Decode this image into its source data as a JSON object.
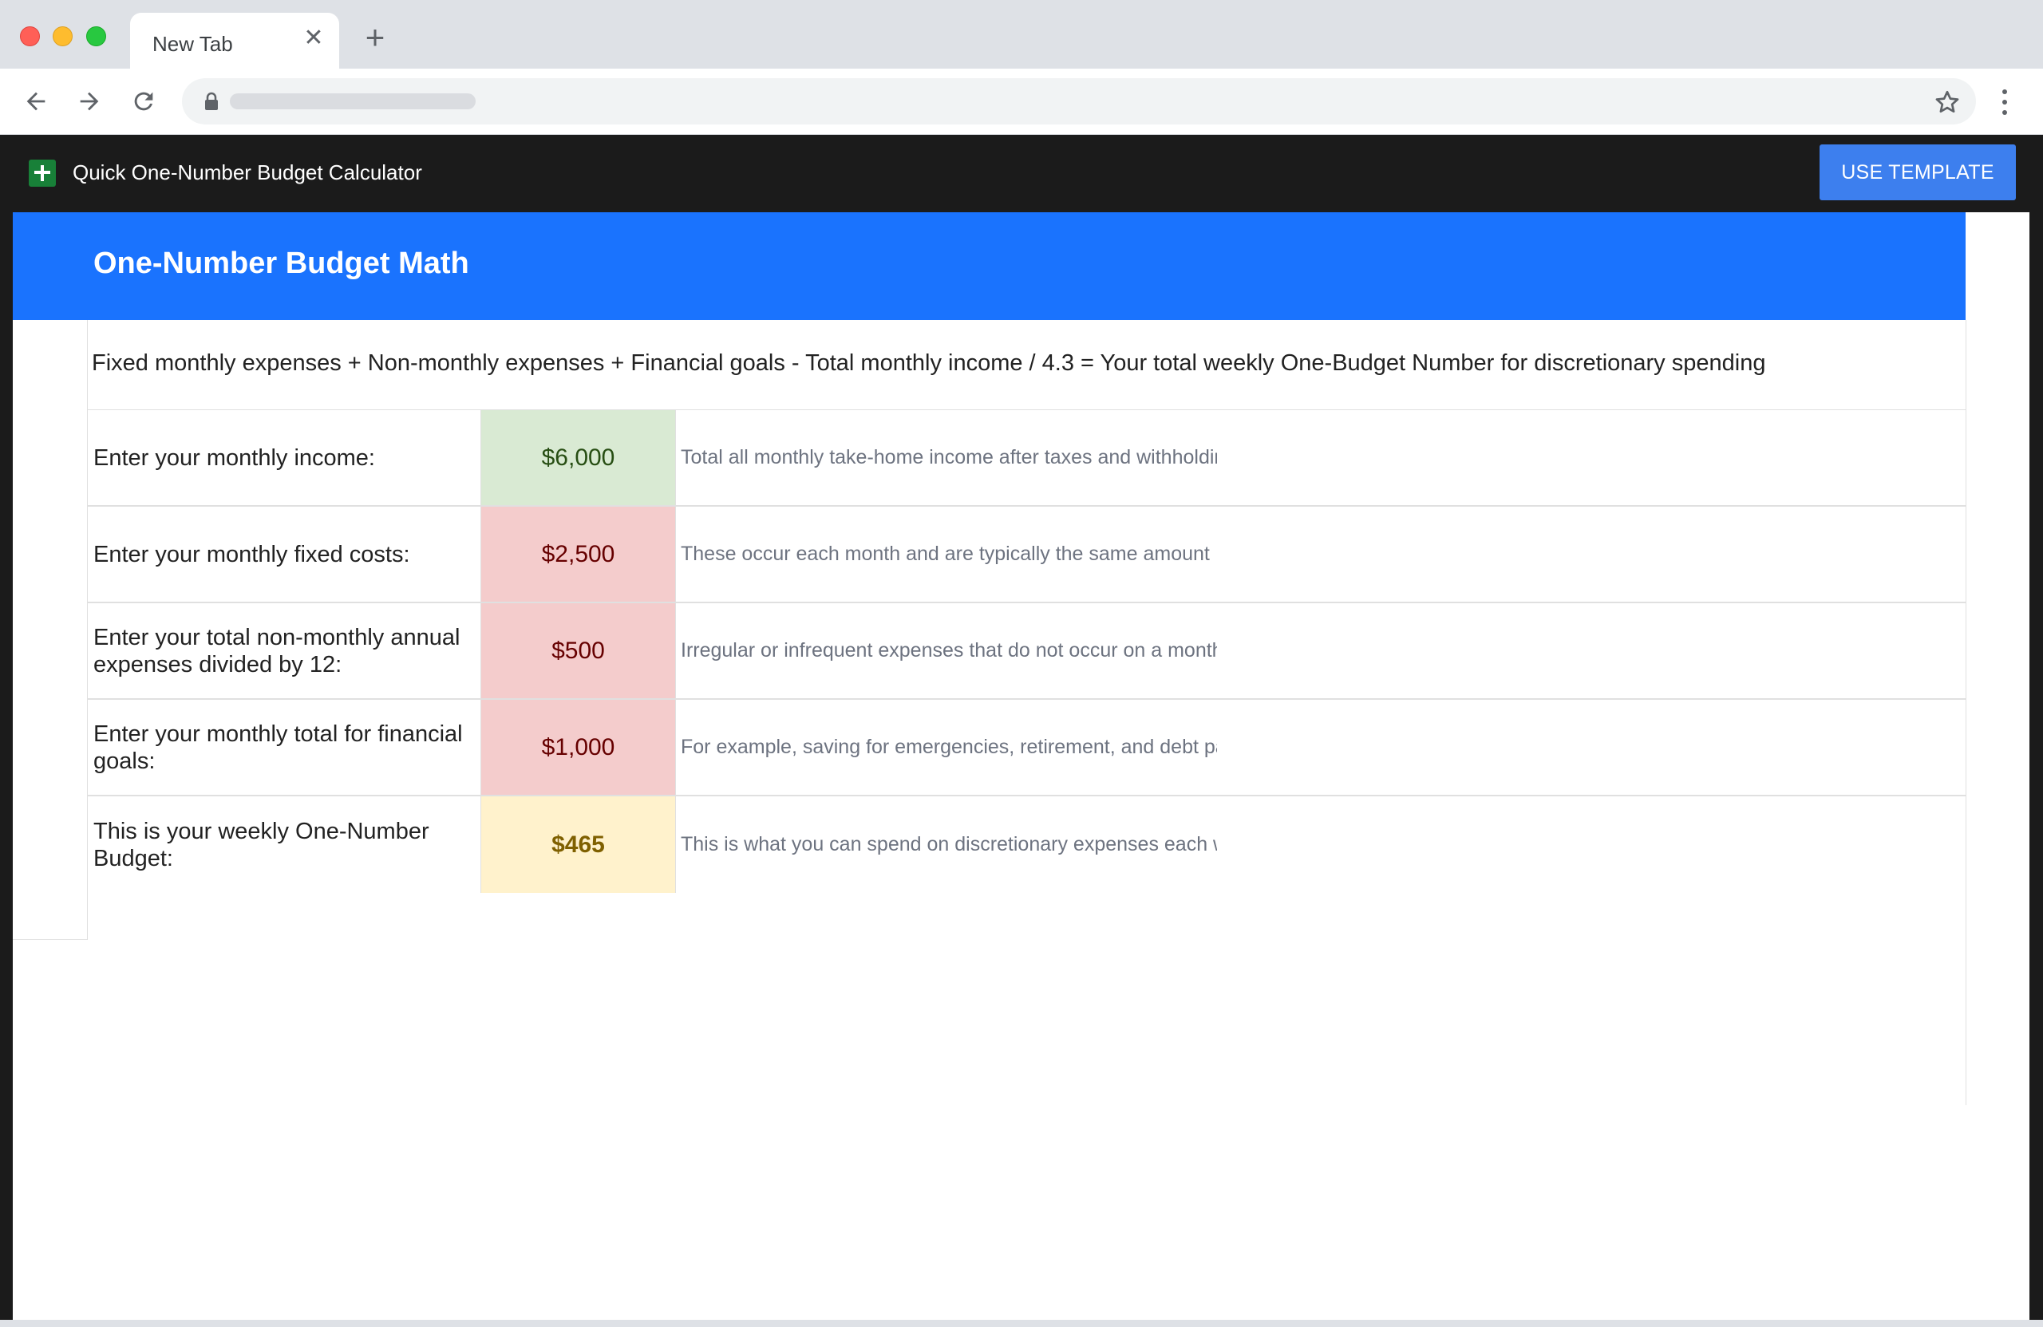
{
  "browser": {
    "tab_title": "New Tab",
    "close_glyph": "✕",
    "new_tab_glyph": "+",
    "url": ""
  },
  "app": {
    "title": "Quick One-Number Budget Calculator",
    "use_template_label": "USE TEMPLATE",
    "logo": "sheets-icon"
  },
  "sheet": {
    "banner_title": "One-Number Budget Math",
    "formula": "Fixed monthly expenses + Non-monthly expenses + Financial goals - Total monthly income / 4.3 = Your total weekly One-Budget Number for discretionary spending",
    "rows": [
      {
        "label": "Enter your monthly income:",
        "value": "$6,000",
        "note": "Total all monthly take-home income after taxes and withholdings"
      },
      {
        "label": "Enter your monthly fixed costs:",
        "value": "$2,500",
        "note": "These occur each month and are typically the same amount"
      },
      {
        "label": "Enter your total non-monthly annual expenses divided by 12:",
        "value": "$500",
        "note": "Irregular or infrequent expenses that do not occur on a monthly basis"
      },
      {
        "label": "Enter your monthly total for financial goals:",
        "value": "$1,000",
        "note": "For example, saving for emergencies, retirement, and debt payoff"
      },
      {
        "label": "This is your weekly One-Number Budget:",
        "value": "$465",
        "note": "This is what you can spend on discretionary expenses each week"
      }
    ]
  },
  "colors": {
    "banner": "#1a73fe",
    "button": "#3d7fee",
    "income_cell": "#d9ead3",
    "expense_cell": "#f4cccc",
    "result_cell": "#fff2cc"
  }
}
